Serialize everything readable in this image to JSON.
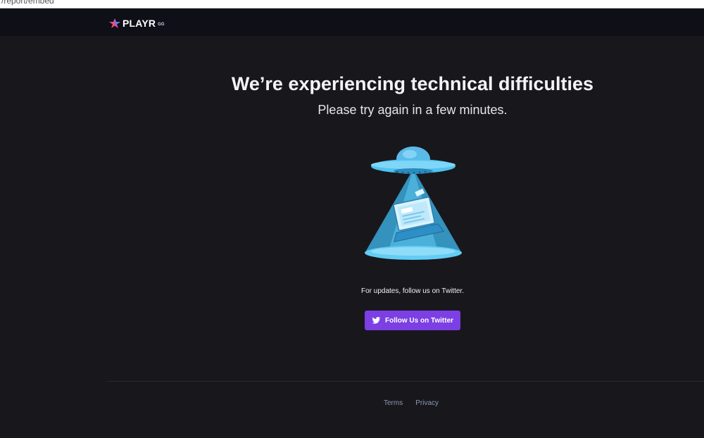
{
  "browser": {
    "url_fragment": "/report/embed"
  },
  "nav": {
    "logo_text": "PLAYR",
    "logo_sub": "GG"
  },
  "main": {
    "headline": "We’re experiencing technical difficulties",
    "subline": "Please try again in a few minutes.",
    "illustration": "ufo-abducting-laptop",
    "updates_text": "For updates, follow us on Twitter.",
    "twitter_button": {
      "label": "Follow Us on Twitter",
      "icon": "twitter-bird-icon"
    }
  },
  "footer": {
    "links": [
      "Terms",
      "Privacy"
    ]
  },
  "colors": {
    "background": "#18171c",
    "nav_background": "#0f0f17",
    "button_purple": "#7b3fe4",
    "ufo_blue": "#4fc3f0",
    "footer_link": "#8a9bb5"
  }
}
